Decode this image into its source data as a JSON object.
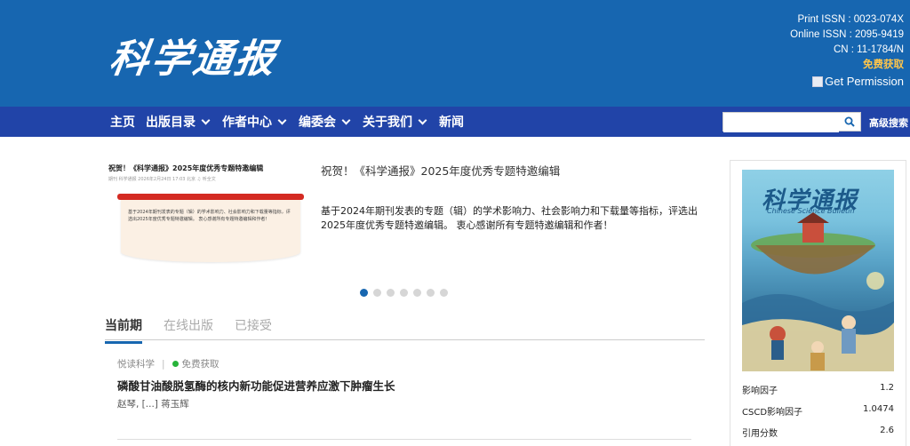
{
  "header": {
    "logo_text": "科学通报",
    "print_issn": "Print ISSN : 0023-074X",
    "online_issn": "Online ISSN : 2095-9419",
    "cn": "CN : 11-1784/N",
    "free_access": "免费获取",
    "permission_alt": "Get Permission",
    "bg_color": "#1766b0"
  },
  "nav": {
    "bg_color": "#2144a8",
    "items": [
      {
        "label": "主页",
        "has_dropdown": false
      },
      {
        "label": "出版目录",
        "has_dropdown": true
      },
      {
        "label": "作者中心",
        "has_dropdown": true
      },
      {
        "label": "编委会",
        "has_dropdown": true
      },
      {
        "label": "关于我们",
        "has_dropdown": true
      },
      {
        "label": "新闻",
        "has_dropdown": false
      }
    ],
    "search_placeholder": "",
    "search_icon": "search-icon",
    "advanced_search": "高级搜索"
  },
  "carousel": {
    "thumb_title": "祝贺！《科学通报》2025年度优秀专题特邀编辑",
    "thumb_meta": "期刊  科学通报  2026年2月24日 17:03  北京  ♫ 听全文",
    "thumb_body": "基于2024年期刊发表的专题（辑）的学术影响力、社会影响力和下载量等指标，评选出2025年度优秀专题特邀编辑。 衷心感谢所有专题特邀编辑和作者！",
    "title": "祝贺！《科学通报》2025年度优秀专题特邀编辑",
    "description": "基于2024年期刊发表的专题（辑）的学术影响力、社会影响力和下载量等指标，评选出2025年度优秀专题特邀编辑。 衷心感谢所有专题特邀编辑和作者！",
    "dot_count": 7,
    "active_dot": 0
  },
  "tabs": [
    {
      "label": "当前期",
      "active": true
    },
    {
      "label": "在线出版",
      "active": false
    },
    {
      "label": "已接受",
      "active": false
    }
  ],
  "article": {
    "category": "悦读科学",
    "separator": "|",
    "free_label": "免费获取",
    "title": "磷酸甘油酸脱氢酶的核内新功能促进营养应激下肿瘤生长",
    "authors": "赵琴, [...] 蒋玉辉"
  },
  "sidebar": {
    "cover_title": "科学通报",
    "cover_subtitle": "Chinese Science Bulletin",
    "metrics": [
      {
        "label": "影响因子",
        "value": "1.2"
      },
      {
        "label": "CSCD影响因子",
        "value": "1.0474"
      },
      {
        "label": "引用分数",
        "value": "2.6"
      }
    ]
  }
}
